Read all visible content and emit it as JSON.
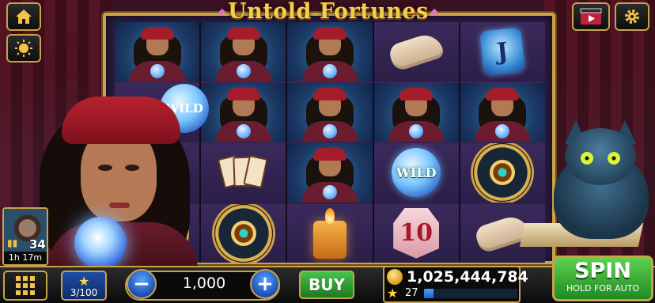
{
  "game": {
    "title": "Untold Fortunes"
  },
  "top_buttons": {
    "home_icon": "home-icon",
    "sun_icon": "sun-icon",
    "video_icon": "video-icon",
    "settings_icon": "gear-icon"
  },
  "reels": [
    [
      "gypsy",
      "wild-orb-partial",
      "cards",
      "wheel"
    ],
    [
      "gypsy",
      "gypsy",
      "gypsy-partial",
      "wheel"
    ],
    [
      "gypsy",
      "gypsy",
      "gypsy",
      "candle"
    ],
    [
      "hand",
      "gypsy",
      "wild",
      "ten"
    ],
    [
      "J",
      "gypsy",
      "wheel",
      "hand"
    ]
  ],
  "symbols": {
    "wild_label": "WILD",
    "letter_j": "J",
    "ten_label": "10"
  },
  "player": {
    "level_count": "34",
    "timer": "1h 17m"
  },
  "bottom": {
    "level_progress": "3/100",
    "bet_value": "1,000",
    "buy_label": "BUY",
    "coins": "1,025,444,784",
    "xp_level": "27",
    "xp_fraction": 0.1,
    "spin_label": "SPIN",
    "spin_sub": "HOLD FOR AUTO"
  },
  "colors": {
    "gold_border": "#c9a24a",
    "spin_green": "#2ea032",
    "bet_blue": "#1a4eb5"
  }
}
